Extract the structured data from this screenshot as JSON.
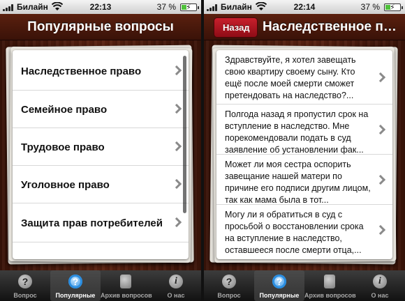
{
  "status": {
    "carrier": "Билайн",
    "battery": "37 %",
    "battery_level": 0.37
  },
  "left": {
    "time": "22:13",
    "title": "Популярные вопросы",
    "items": [
      {
        "label": "Наследственное право"
      },
      {
        "label": "Семейное право"
      },
      {
        "label": "Трудовое право"
      },
      {
        "label": "Уголовное право"
      },
      {
        "label": "Защита прав потребителей"
      }
    ]
  },
  "right": {
    "time": "22:14",
    "back_label": "Назад",
    "title": "Наследственное пр...",
    "questions": [
      {
        "text": "Здравствуйте, я хотел завещать свою квартиру своему сыну. Кто ещё после моей смерти сможет претендовать на наследство?..."
      },
      {
        "text": "Полгода назад я пропустил срок на вступление в наследство. Мне порекомендовали подать в суд заявление об установлении фак..."
      },
      {
        "text": "Может ли моя сестра оспорить завещание нашей матери по причине его подписи другим лицом, так как мама была в тот..."
      },
      {
        "text": "Могу ли я обратиться в суд с просьбой о восстановлении срока на вступление в наследство, оставшееся после смерти отца,..."
      }
    ]
  },
  "tabs": [
    {
      "label": "Вопрос",
      "icon": "question-icon"
    },
    {
      "label": "Популярные",
      "icon": "gear-question-icon"
    },
    {
      "label": "Архив вопросов",
      "icon": "book-icon"
    },
    {
      "label": "О нас",
      "icon": "info-icon"
    }
  ],
  "tab_glyphs": {
    "question": "?",
    "info": "i"
  },
  "colors": {
    "nav": "#4a1a0c",
    "back_button": "#b0151f",
    "active_tab": "#2a8de0"
  }
}
